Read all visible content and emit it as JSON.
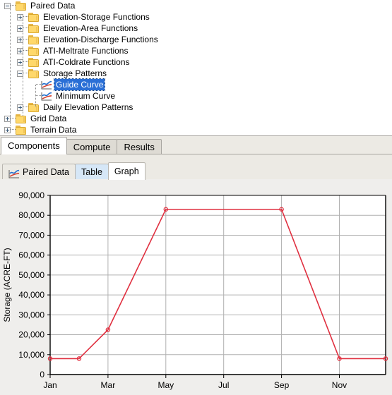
{
  "tree": {
    "items": [
      {
        "label": "Paired Data",
        "depth": 0,
        "toggle": "minus",
        "icon": "folder-icon",
        "selected": false
      },
      {
        "label": "Elevation-Storage Functions",
        "depth": 1,
        "toggle": "plus",
        "icon": "folder-icon",
        "selected": false
      },
      {
        "label": "Elevation-Area Functions",
        "depth": 1,
        "toggle": "plus",
        "icon": "folder-icon",
        "selected": false
      },
      {
        "label": "Elevation-Discharge Functions",
        "depth": 1,
        "toggle": "plus",
        "icon": "folder-icon",
        "selected": false
      },
      {
        "label": "ATI-Meltrate Functions",
        "depth": 1,
        "toggle": "plus",
        "icon": "folder-icon",
        "selected": false
      },
      {
        "label": "ATI-Coldrate Functions",
        "depth": 1,
        "toggle": "plus",
        "icon": "folder-icon",
        "selected": false
      },
      {
        "label": "Storage Patterns",
        "depth": 1,
        "toggle": "minus",
        "icon": "folder-icon",
        "selected": false
      },
      {
        "label": "Guide Curve",
        "depth": 2,
        "toggle": "none",
        "icon": "curve-icon",
        "selected": true
      },
      {
        "label": "Minimum Curve",
        "depth": 2,
        "toggle": "none",
        "icon": "curve-icon",
        "selected": false
      },
      {
        "label": "Daily Elevation Patterns",
        "depth": 1,
        "toggle": "plus",
        "icon": "folder-icon",
        "selected": false
      },
      {
        "label": "Grid Data",
        "depth": 0,
        "toggle": "plus",
        "icon": "folder-icon",
        "selected": false
      },
      {
        "label": "Terrain Data",
        "depth": 0,
        "toggle": "plus",
        "icon": "folder-icon",
        "selected": false
      }
    ],
    "selection_color": "#2a6fd6"
  },
  "main_tabs": {
    "items": [
      {
        "label": "Components",
        "active": true
      },
      {
        "label": "Compute",
        "active": false
      },
      {
        "label": "Results",
        "active": false
      }
    ]
  },
  "sub_tabs": {
    "items": [
      {
        "label": "Paired Data",
        "active": false,
        "lit": false,
        "icon": "curve-icon"
      },
      {
        "label": "Table",
        "active": false,
        "lit": true,
        "icon": "none"
      },
      {
        "label": "Graph",
        "active": true,
        "lit": false,
        "icon": "none"
      }
    ]
  },
  "chart_data": {
    "type": "line",
    "title": "",
    "xlabel": "",
    "ylabel": "Storage (ACRE-FT)",
    "ylim": [
      0,
      90000
    ],
    "ytick_labels": [
      "0",
      "10,000",
      "20,000",
      "30,000",
      "40,000",
      "50,000",
      "60,000",
      "70,000",
      "80,000",
      "90,000"
    ],
    "ytick_values": [
      0,
      10000,
      20000,
      30000,
      40000,
      50000,
      60000,
      70000,
      80000,
      90000
    ],
    "xtick_labels": [
      "Jan",
      "Mar",
      "May",
      "Jul",
      "Sep",
      "Nov"
    ],
    "xtick_values": [
      1,
      3,
      5,
      7,
      9,
      11
    ],
    "xlim": [
      1,
      12.6
    ],
    "grid": true,
    "legend": "none",
    "series": [
      {
        "name": "Guide Curve",
        "color": "#e03040",
        "marker": "open-circle",
        "x": [
          1,
          2,
          3,
          5,
          9,
          11,
          12.6
        ],
        "values": [
          8000,
          8000,
          22500,
          83000,
          83000,
          8000,
          8000
        ]
      }
    ],
    "plot_bg": "#ffffff",
    "panel_bg": "#efeeec",
    "grid_color": "#b0b0b0",
    "axis_color": "#000000"
  }
}
